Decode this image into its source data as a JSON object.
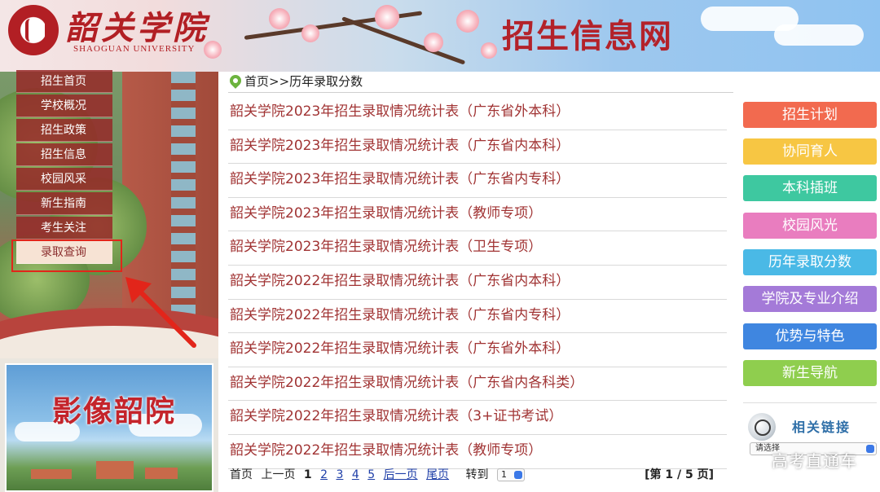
{
  "header": {
    "school_name": "韶关学院",
    "school_name_en": "SHAOGUAN UNIVERSITY",
    "site_title": "招生信息网"
  },
  "nav": {
    "items": [
      {
        "label": "招生首页",
        "active": false
      },
      {
        "label": "学校概况",
        "active": false
      },
      {
        "label": "招生政策",
        "active": false
      },
      {
        "label": "招生信息",
        "active": false
      },
      {
        "label": "校园风采",
        "active": false
      },
      {
        "label": "新生指南",
        "active": false
      },
      {
        "label": "考生关注",
        "active": false
      },
      {
        "label": "录取查询",
        "active": true
      }
    ]
  },
  "photo_panel": {
    "title": "影像韶院"
  },
  "breadcrumb": {
    "text": "首页>>历年录取分数"
  },
  "list": {
    "items": [
      "韶关学院2023年招生录取情况统计表（广东省外本科）",
      "韶关学院2023年招生录取情况统计表（广东省内本科）",
      "韶关学院2023年招生录取情况统计表（广东省内专科）",
      "韶关学院2023年招生录取情况统计表（教师专项）",
      "韶关学院2023年招生录取情况统计表（卫生专项）",
      "韶关学院2022年招生录取情况统计表（广东省内本科）",
      "韶关学院2022年招生录取情况统计表（广东省内专科）",
      "韶关学院2022年招生录取情况统计表（广东省外本科）",
      "韶关学院2022年招生录取情况统计表（广东省内各科类）",
      "韶关学院2022年招生录取情况统计表（3+证书考试）",
      "韶关学院2022年招生录取情况统计表（教师专项）"
    ]
  },
  "pager": {
    "first": "首页",
    "prev": "上一页",
    "current": "1",
    "pages": [
      "2",
      "3",
      "4",
      "5"
    ],
    "next": "后一页",
    "last": "尾页",
    "goto_label": "转到",
    "goto_value": "1",
    "summary": "[第 1 / 5 页]"
  },
  "right_buttons": [
    {
      "label": "招生计划",
      "color": "#f26a4f"
    },
    {
      "label": "协同育人",
      "color": "#f7c643"
    },
    {
      "label": "本科插班",
      "color": "#3ec8a0"
    },
    {
      "label": "校园风光",
      "color": "#e97dbf"
    },
    {
      "label": "历年录取分数",
      "color": "#4ab9e6"
    },
    {
      "label": "学院及专业介绍",
      "color": "#a47ad8"
    },
    {
      "label": "优势与特色",
      "color": "#3f86e0"
    },
    {
      "label": "新生导航",
      "color": "#8fce4e"
    }
  ],
  "links": {
    "title": "相关链接",
    "select_value": "请选择"
  },
  "watermark": "高考直通车"
}
